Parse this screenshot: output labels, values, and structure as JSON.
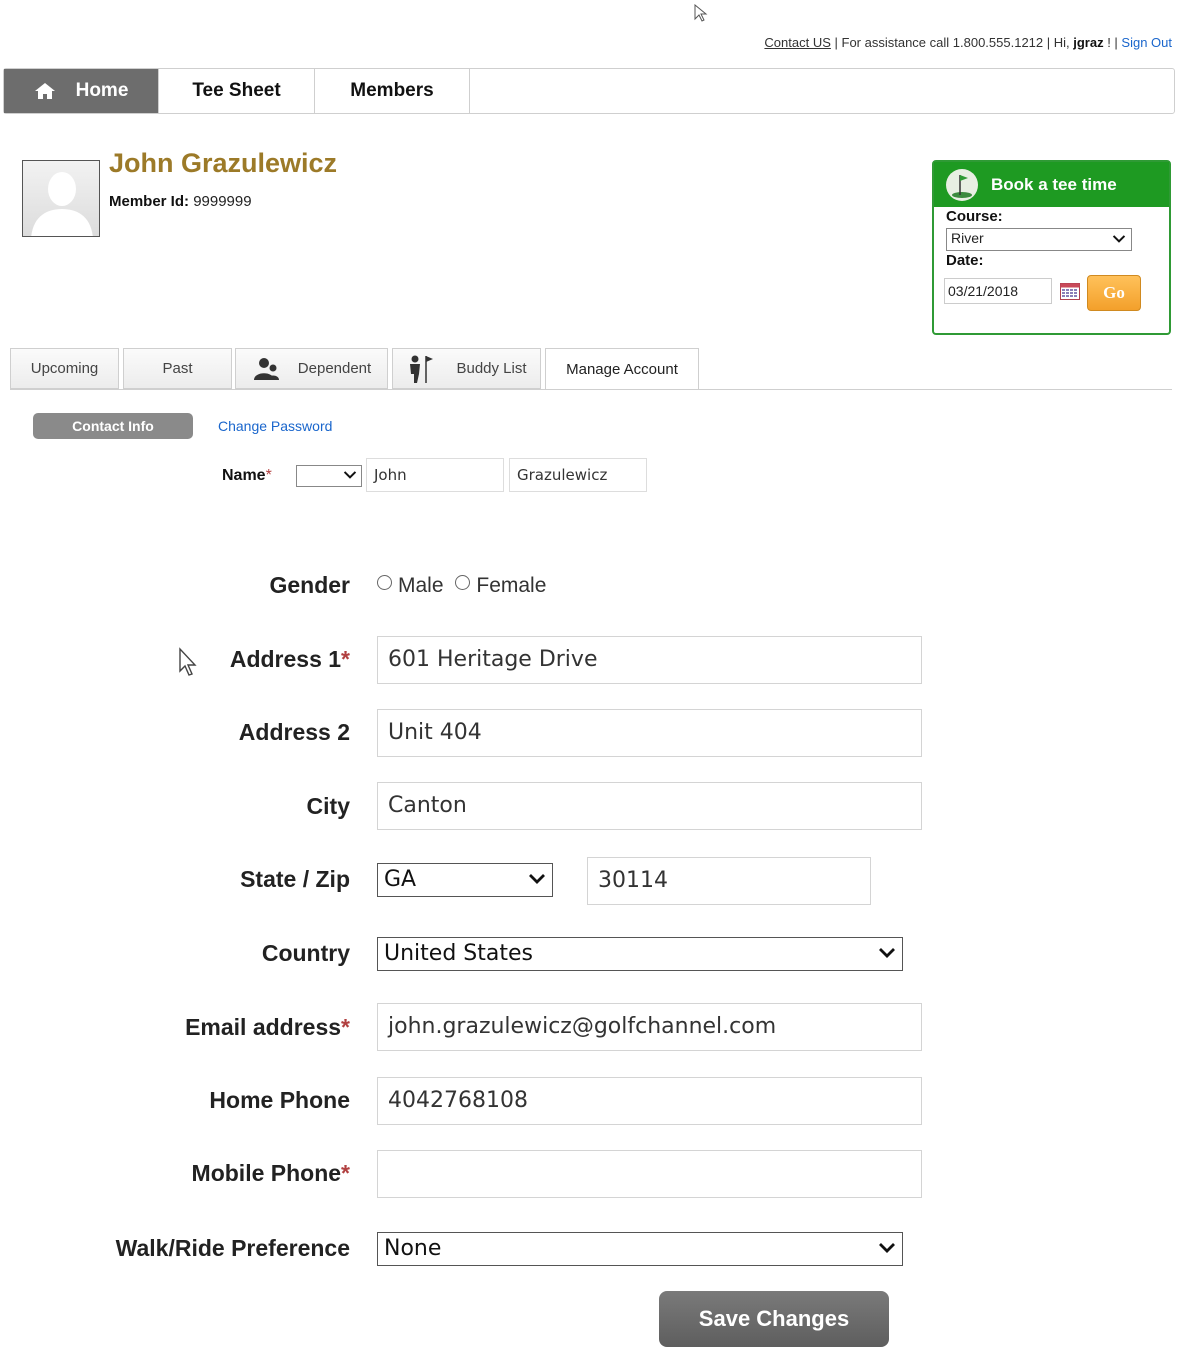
{
  "header": {
    "contact_link": "Contact US",
    "assist_prefix": " | For assistance call 1.800.555.1212 | Hi, ",
    "username": "jgraz",
    "assist_suffix": " ! | ",
    "sign_out": "Sign Out"
  },
  "nav": {
    "home": "Home",
    "tee_sheet": "Tee Sheet",
    "members": "Members"
  },
  "profile": {
    "name": "John Grazulewicz",
    "member_id_label": "Member Id:",
    "member_id": "9999999"
  },
  "book": {
    "title": "Book a tee time",
    "course_label": "Course:",
    "course_value": "River",
    "date_label": "Date:",
    "date_value": "03/21/2018",
    "go": "Go"
  },
  "tabs": {
    "upcoming": "Upcoming",
    "past": "Past",
    "dependent": "Dependent",
    "buddy_list": "Buddy List",
    "manage_account": "Manage Account"
  },
  "subnav": {
    "contact_info": "Contact Info",
    "change_password": "Change Password"
  },
  "form": {
    "name_label": "Name",
    "first_name": "John",
    "last_name": "Grazulewicz",
    "gender_label": "Gender",
    "gender_options": [
      "Male",
      "Female"
    ],
    "address1_label": "Address 1",
    "address1": "601 Heritage Drive",
    "address2_label": "Address 2",
    "address2": "Unit 404",
    "city_label": "City",
    "city": "Canton",
    "state_zip_label": "State / Zip",
    "state": "GA",
    "zip": "30114",
    "country_label": "Country",
    "country": "United States",
    "email_label": "Email address",
    "email": "john.grazulewicz@golfchannel.com",
    "home_phone_label": "Home Phone",
    "home_phone": "4042768108",
    "mobile_phone_label": "Mobile Phone",
    "mobile_phone": "",
    "walk_ride_label": "Walk/Ride Preference",
    "walk_ride": "None",
    "required_mark": "*",
    "save": "Save Changes"
  },
  "colors": {
    "brand_gold": "#9c7a28",
    "tee_green": "#1e9a22",
    "go_orange": "#f3a02b",
    "link_blue": "#1a66cc",
    "nav_active": "#6d6d6d"
  },
  "icons": [
    "home-icon",
    "golf-flag-icon",
    "calendar-icon",
    "dependent-icon",
    "buddy-icon",
    "chevron-down-icon",
    "mouse-cursor-icon"
  ]
}
